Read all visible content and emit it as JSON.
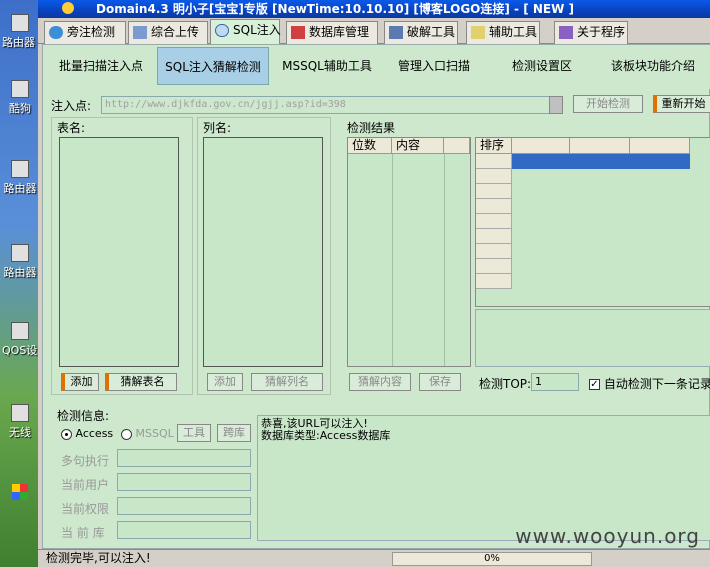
{
  "window": {
    "title": "Domain4.3 明小子[宝宝]专版 [NewTime:10.10.10] [博客LOGO连接]  - [ NEW ]"
  },
  "desktop_icons": [
    {
      "label": "路由器 经验"
    },
    {
      "label": "酷狗"
    },
    {
      "label": "路由器"
    },
    {
      "label": "路由器"
    },
    {
      "label": "QOS设置"
    },
    {
      "label": "无线"
    }
  ],
  "tabs": [
    {
      "label": "旁注检测",
      "icon": "globe-icon"
    },
    {
      "label": "综合上传",
      "icon": "upload-icon"
    },
    {
      "label": "SQL注入",
      "icon": "search-icon",
      "active": true
    },
    {
      "label": "数据库管理",
      "icon": "database-icon"
    },
    {
      "label": "破解工具",
      "icon": "keyboard-icon"
    },
    {
      "label": "辅助工具",
      "icon": "notepad-icon"
    },
    {
      "label": "关于程序",
      "icon": "book-icon"
    }
  ],
  "subtabs": [
    {
      "label": "批量扫描注入点"
    },
    {
      "label": "SQL注入猜解检测",
      "active": true
    },
    {
      "label": "MSSQL辅助工具"
    },
    {
      "label": "管理入口扫描"
    },
    {
      "label": "检测设置区"
    },
    {
      "label": "该板块功能介绍"
    }
  ],
  "injection": {
    "label": "注入点:",
    "url": "http://www.djkfda.gov.cn/jgjj.asp?id=398",
    "start_button": "开始检测",
    "restart_button": "重新开始"
  },
  "tables": {
    "label": "表名:",
    "add_button": "添加",
    "guess_button": "猜解表名"
  },
  "columns": {
    "label": "列名:",
    "add_button": "添加",
    "guess_button": "猜解列名"
  },
  "results": {
    "label": "检测结果",
    "col_pos": "位数",
    "col_content": "内容",
    "guess_content_button": "猜解内容",
    "save_button": "保存",
    "top_label": "检测TOP:",
    "top_value": "1",
    "auto_label": "自动检测下一条记录",
    "sort_label": "排序"
  },
  "info": {
    "label": "检测信息:",
    "access": "Access",
    "mssql": "MSSQL",
    "tool_button": "工具",
    "span_button": "跨库",
    "multi_exec": "多句执行",
    "current_user": "当前用户",
    "current_perm": "当前权限",
    "current_db": "当 前 库",
    "log_line1": "恭喜,该URL可以注入!",
    "log_line2": "数据库类型:Access数据库"
  },
  "status": {
    "text": "检测完毕,可以注入!",
    "progress": "0%"
  },
  "watermark": "www.wooyun.org"
}
